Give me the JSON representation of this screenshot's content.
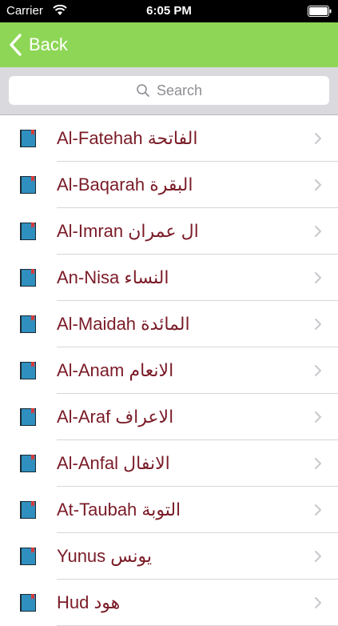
{
  "status_bar": {
    "carrier": "Carrier",
    "time": "6:05 PM"
  },
  "nav": {
    "back_label": "Back"
  },
  "search": {
    "placeholder": "Search"
  },
  "colors": {
    "nav_green": "#8dd656",
    "text_maroon": "#7a1b27",
    "book_blue": "#2f8fbf"
  },
  "surahs": [
    {
      "name": "Al-Fatehah الفاتحة"
    },
    {
      "name": "Al-Baqarah البقرة"
    },
    {
      "name": "Al-Imran ال عمران"
    },
    {
      "name": "An-Nisa النساء"
    },
    {
      "name": "Al-Maidah المائدة"
    },
    {
      "name": "Al-Anam الانعام"
    },
    {
      "name": "Al-Araf الاعراف"
    },
    {
      "name": "Al-Anfal الانفال"
    },
    {
      "name": "At-Taubah التوبة"
    },
    {
      "name": "Yunus يونس"
    },
    {
      "name": "Hud هود"
    }
  ]
}
